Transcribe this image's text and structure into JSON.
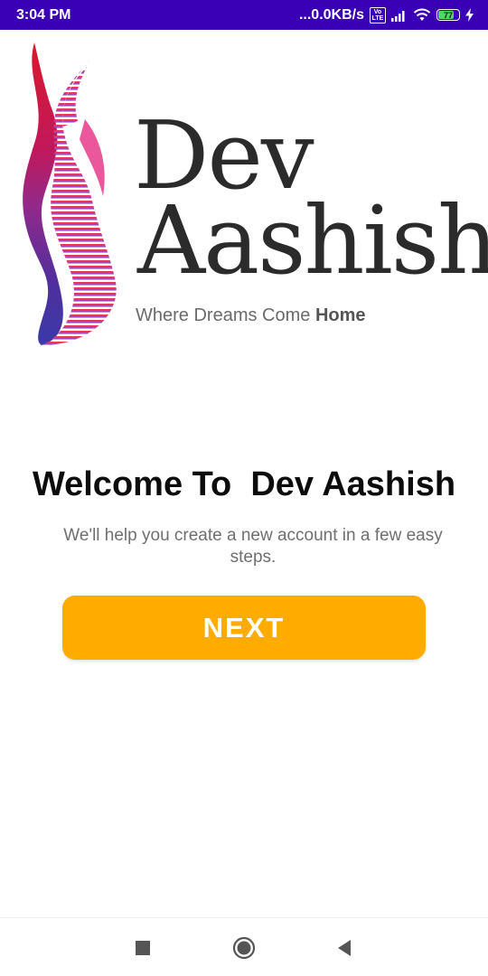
{
  "status_bar": {
    "time": "3:04 PM",
    "network_speed": "...0.0KB/s",
    "volte_label": "Vo LTE",
    "battery_level": "77",
    "icons": [
      "volte-icon",
      "signal-icon",
      "wifi-icon",
      "battery-icon",
      "charging-icon"
    ]
  },
  "logo": {
    "line1": "Dev",
    "line2": "Aashish",
    "tagline_prefix": "Where Dreams Come ",
    "tagline_bold": "Home",
    "colors": [
      "#d7192c",
      "#e63a8a",
      "#7a3aa0",
      "#3a3aa8"
    ]
  },
  "welcome": {
    "title": "Welcome To  Dev Aashish",
    "subtitle": "We'll help you create a new account in a few easy steps."
  },
  "next_button": {
    "label": "NEXT",
    "color": "#ffab00"
  },
  "nav_bar": {
    "icons": [
      "recents-icon",
      "home-icon",
      "back-icon"
    ]
  }
}
